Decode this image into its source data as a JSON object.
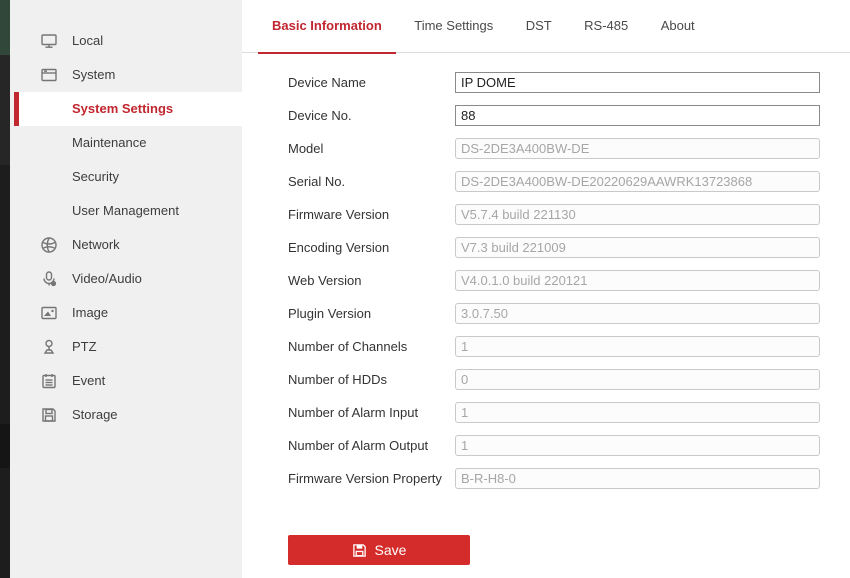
{
  "app": {
    "accent_color": "#c1272f",
    "save_button_color": "#d42b2b"
  },
  "sidebar": {
    "items": [
      {
        "label": "Local",
        "icon": "monitor-icon"
      },
      {
        "label": "System",
        "icon": "system-window-icon"
      },
      {
        "label": "System Settings",
        "selected": true
      },
      {
        "label": "Maintenance"
      },
      {
        "label": "Security"
      },
      {
        "label": "User Management"
      },
      {
        "label": "Network",
        "icon": "network-globe-icon"
      },
      {
        "label": "Video/Audio",
        "icon": "microphone-icon"
      },
      {
        "label": "Image",
        "icon": "image-icon"
      },
      {
        "label": "PTZ",
        "icon": "ptz-joystick-icon"
      },
      {
        "label": "Event",
        "icon": "event-notepad-icon"
      },
      {
        "label": "Storage",
        "icon": "storage-floppy-icon"
      }
    ]
  },
  "tabs": [
    {
      "label": "Basic Information",
      "active": true
    },
    {
      "label": "Time Settings"
    },
    {
      "label": "DST"
    },
    {
      "label": "RS-485"
    },
    {
      "label": "About"
    }
  ],
  "form": {
    "fields": [
      {
        "label": "Device Name",
        "value": "IP DOME",
        "editable": true
      },
      {
        "label": "Device No.",
        "value": "88",
        "editable": true
      },
      {
        "label": "Model",
        "value": "DS-2DE3A400BW-DE",
        "editable": false
      },
      {
        "label": "Serial No.",
        "value": "DS-2DE3A400BW-DE20220629AAWRK13723868",
        "editable": false
      },
      {
        "label": "Firmware Version",
        "value": "V5.7.4 build 221130",
        "editable": false
      },
      {
        "label": "Encoding Version",
        "value": "V7.3 build 221009",
        "editable": false
      },
      {
        "label": "Web Version",
        "value": "V4.0.1.0 build 220121",
        "editable": false
      },
      {
        "label": "Plugin Version",
        "value": "3.0.7.50",
        "editable": false
      },
      {
        "label": "Number of Channels",
        "value": "1",
        "editable": false
      },
      {
        "label": "Number of HDDs",
        "value": "0",
        "editable": false
      },
      {
        "label": "Number of Alarm Input",
        "value": "1",
        "editable": false
      },
      {
        "label": "Number of Alarm Output",
        "value": "1",
        "editable": false
      },
      {
        "label": "Firmware Version Property",
        "value": "B-R-H8-0",
        "editable": false
      }
    ]
  },
  "save_button": {
    "label": "Save",
    "icon": "save-icon"
  }
}
